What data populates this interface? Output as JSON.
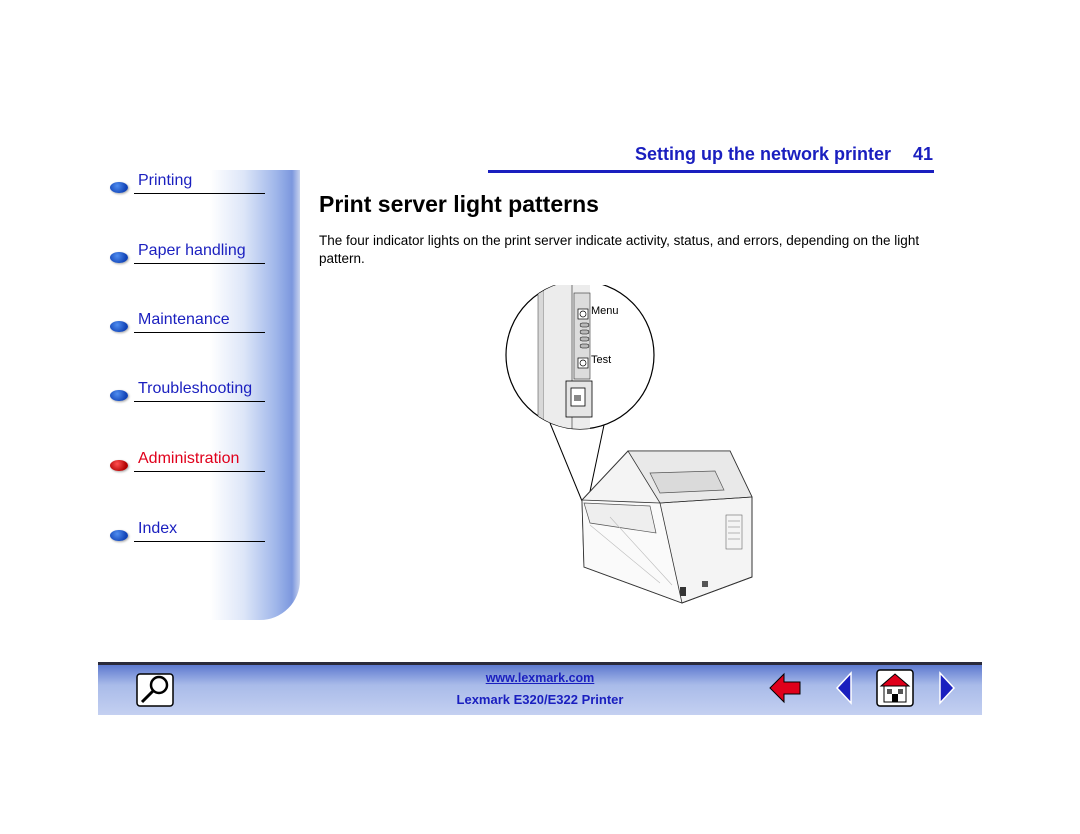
{
  "navigation": {
    "items": [
      {
        "label": "Printing",
        "active": false
      },
      {
        "label": "Paper handling",
        "active": false
      },
      {
        "label": "Maintenance",
        "active": false
      },
      {
        "label": "Troubleshooting",
        "active": false
      },
      {
        "label": "Administration",
        "active": true
      },
      {
        "label": "Index",
        "active": false
      }
    ],
    "active_color": "#e0001b",
    "link_color": "#1a1fbf"
  },
  "header": {
    "section_title": "Setting up the network printer",
    "page_number": "41"
  },
  "content": {
    "title": "Print server light patterns",
    "paragraph": "The four indicator lights on the print server indicate activity, status, and errors, depending on the light pattern.",
    "figure_labels": {
      "menu": "Menu",
      "test": "Test"
    }
  },
  "footer": {
    "url": "www.lexmark.com",
    "product": "Lexmark E320/E322 Printer",
    "icons": [
      "search-icon",
      "back-arrow-icon",
      "previous-page-icon",
      "home-icon",
      "next-page-icon"
    ]
  }
}
